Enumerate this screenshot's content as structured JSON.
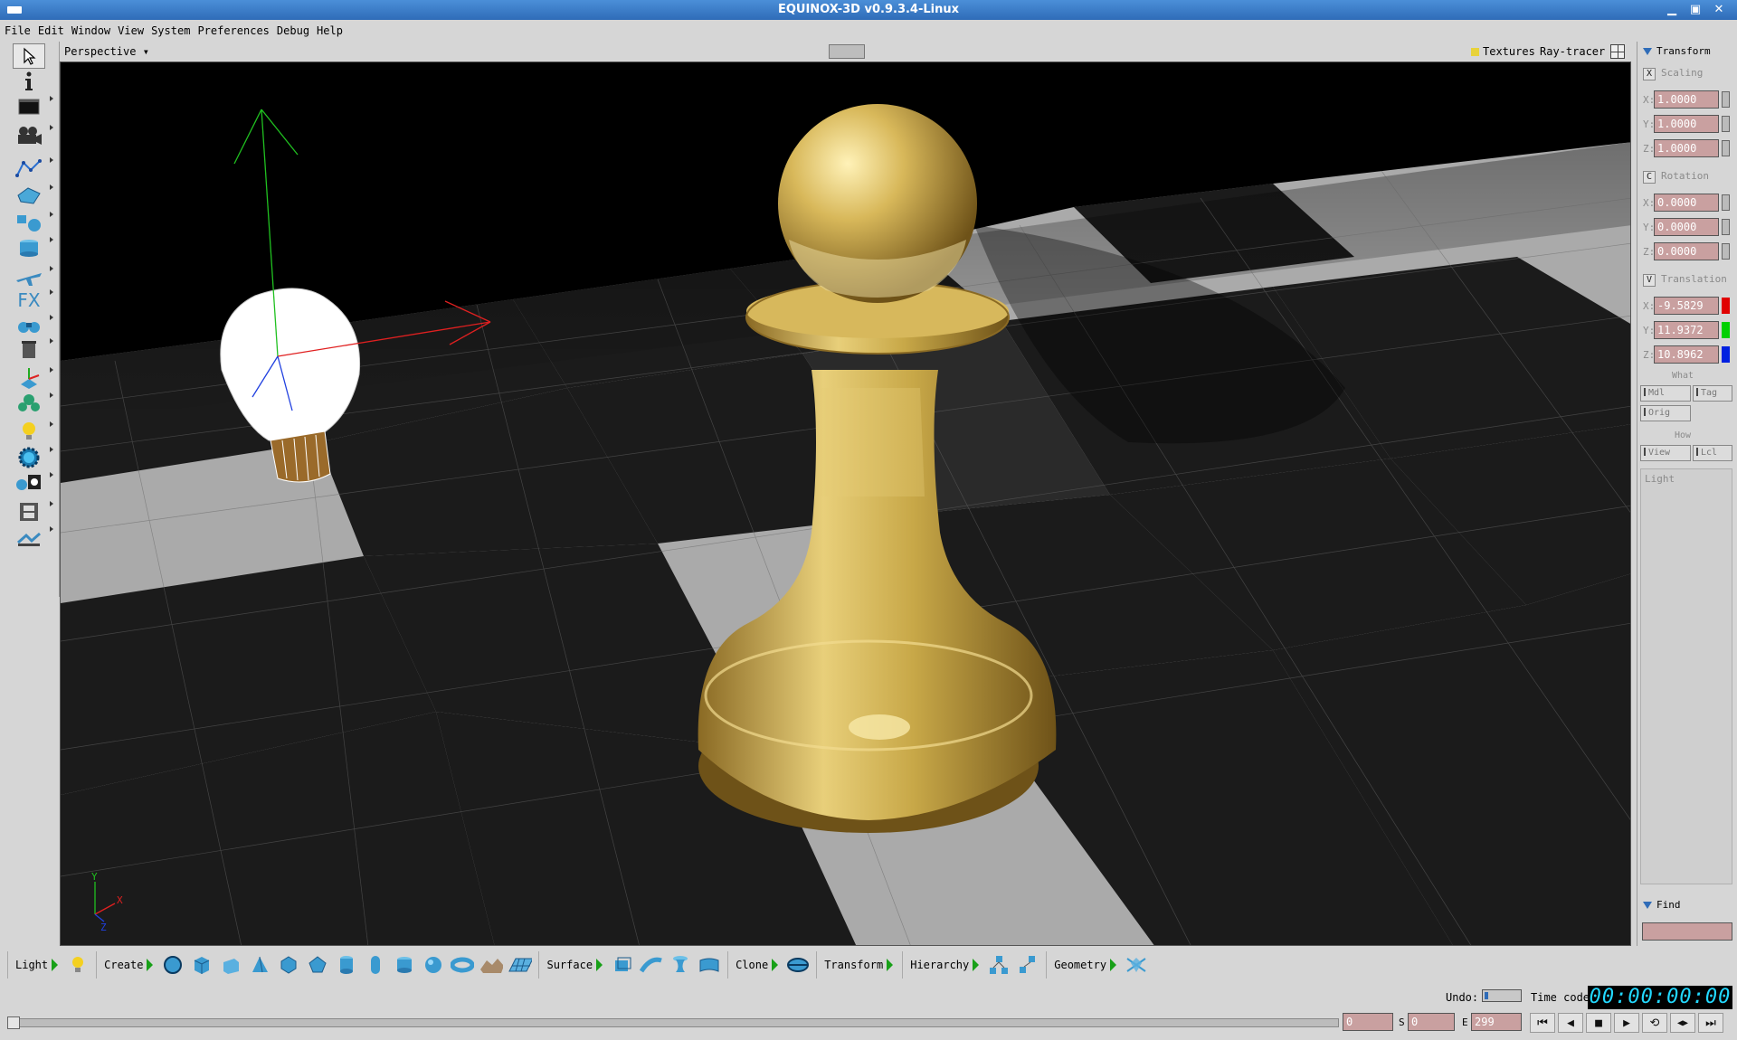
{
  "window": {
    "title": "EQUINOX-3D v0.9.3.4-Linux",
    "min": "▁",
    "max": "▣",
    "close": "✕"
  },
  "menu": [
    "File",
    "Edit",
    "Window",
    "View",
    "System",
    "Preferences",
    "Debug",
    "Help"
  ],
  "left_tools": [
    "pointer-icon",
    "info-icon",
    "window-icon",
    "camera-icon",
    "spline-icon",
    "polygon-icon",
    "transform-shapes-icon",
    "cylinder-icon",
    "airplane-icon",
    "fx-icon",
    "binoculars-icon",
    "trash-icon",
    "axis-object-icon",
    "tree-icon",
    "lightbulb-icon",
    "sphere-gear-icon",
    "material-icon",
    "film-icon",
    "render-icon"
  ],
  "fx_label": "FX",
  "viewport": {
    "view_mode": "Perspective",
    "textures_label": "Textures",
    "renderer": "Ray-tracer",
    "axis_labels": {
      "x": "X",
      "y": "Y",
      "z": "Z"
    },
    "colors": {
      "x_axis": "#e02020",
      "y_axis": "#20c020",
      "z_axis": "#2040e0",
      "gold": "#c8a848"
    }
  },
  "panel": {
    "transform_title": "Transform",
    "scaling": {
      "key": "X",
      "label": "Scaling",
      "x": "1.0000",
      "y": "1.0000",
      "z": "1.0000"
    },
    "rotation": {
      "key": "C",
      "label": "Rotation",
      "x": "0.0000",
      "y": "0.0000",
      "z": "0.0000"
    },
    "translation": {
      "key": "V",
      "label": "Translation",
      "x": "-9.5829",
      "y": "11.9372",
      "z": "10.8962"
    },
    "axis_x": "X:",
    "axis_y": "Y:",
    "axis_z": "Z:",
    "what_label": "What",
    "what_buttons": {
      "mdl": "Mdl",
      "tag": "Tag",
      "orig": "Orig"
    },
    "how_label": "How",
    "how_buttons": {
      "view": "View",
      "lcl": "Lcl"
    },
    "selection_label": "Light",
    "find_title": "Find",
    "find_value": ""
  },
  "bottom": {
    "groups": {
      "light": {
        "label": "Light",
        "icons": [
          "lightbulb-icon"
        ]
      },
      "create": {
        "label": "Create",
        "icons": [
          "sphere-icon",
          "cube-icon",
          "box-icon",
          "pyramid-icon",
          "dodecahedron-icon",
          "icosahedron-icon",
          "cylinder-icon",
          "capsule-icon",
          "disc-icon",
          "ball-icon",
          "torus-icon",
          "terrain-icon",
          "grid-plane-icon"
        ]
      },
      "surface": {
        "label": "Surface",
        "icons": [
          "extrude-icon",
          "sweep-icon",
          "lathe-icon",
          "skin-icon"
        ]
      },
      "clone": {
        "label": "Clone",
        "icons": [
          "clone-icon"
        ]
      },
      "transform": {
        "label": "Transform",
        "icons": []
      },
      "hierarchy": {
        "label": "Hierarchy",
        "icons": [
          "hierarchy-link-icon",
          "hierarchy-unlink-icon"
        ]
      },
      "geometry": {
        "label": "Geometry",
        "icons": [
          "geometry-icon"
        ]
      }
    },
    "undo_label": "Undo:",
    "timecode_label": "Time code",
    "timecode": "00:00:00:00",
    "timeline": {
      "current": "0",
      "start_label": "S",
      "start": "0",
      "end_label": "E",
      "end": "299"
    },
    "playback": [
      "⏮",
      "◀",
      "■",
      "▶",
      "⟲",
      "◀▶",
      "⏭"
    ]
  }
}
